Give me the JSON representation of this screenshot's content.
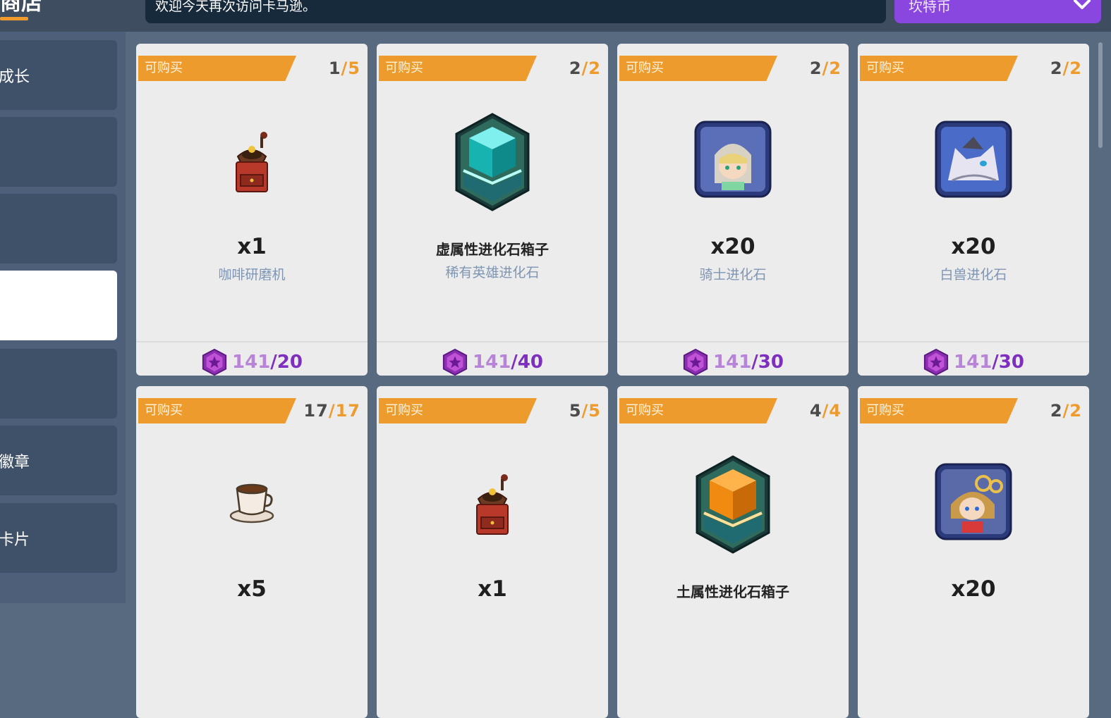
{
  "header": {
    "title": "商店",
    "marquee": "欢迎今天再次访问卡马逊。",
    "currency": "坎特币"
  },
  "sidebar": {
    "items": [
      {
        "label": "成长"
      },
      {
        "label": ""
      },
      {
        "label": ""
      },
      {
        "label": ""
      },
      {
        "label": ""
      },
      {
        "label": "徽章"
      },
      {
        "label": "卡片"
      }
    ]
  },
  "shop": {
    "items": [
      {
        "tag": "可购买",
        "bought": "1",
        "limit": "5",
        "qty": "x1",
        "name": "",
        "sub": "咖啡研磨机",
        "icon": "coffee-grinder-icon",
        "have": "141",
        "cost": "20"
      },
      {
        "tag": "可购买",
        "bought": "2",
        "limit": "2",
        "qty": "",
        "name": "虚属性进化石箱子",
        "sub": "稀有英雄进化石",
        "icon": "cyan-evolution-box-icon",
        "have": "141",
        "cost": "40"
      },
      {
        "tag": "可购买",
        "bought": "2",
        "limit": "2",
        "qty": "x20",
        "name": "",
        "sub": "骑士进化石",
        "icon": "knight-portrait-icon",
        "have": "141",
        "cost": "30"
      },
      {
        "tag": "可购买",
        "bought": "2",
        "limit": "2",
        "qty": "x20",
        "name": "",
        "sub": "白兽进化石",
        "icon": "white-beast-portrait-icon",
        "have": "141",
        "cost": "30"
      },
      {
        "tag": "可购买",
        "bought": "17",
        "limit": "17",
        "qty": "x5",
        "name": "",
        "sub": "",
        "icon": "coffee-cup-icon"
      },
      {
        "tag": "可购买",
        "bought": "5",
        "limit": "5",
        "qty": "x1",
        "name": "",
        "sub": "",
        "icon": "coffee-grinder-icon"
      },
      {
        "tag": "可购买",
        "bought": "4",
        "limit": "4",
        "qty": "",
        "name": "土属性进化石箱子",
        "sub": "",
        "icon": "orange-evolution-box-icon"
      },
      {
        "tag": "可购买",
        "bought": "2",
        "limit": "2",
        "qty": "x20",
        "name": "",
        "sub": "",
        "icon": "goggles-girl-portrait-icon"
      }
    ]
  },
  "colors": {
    "tag": "#ee9b2e",
    "currency_select": "#8a47e0",
    "price": "#7e2fc0",
    "sidebar": "#4e6079"
  }
}
